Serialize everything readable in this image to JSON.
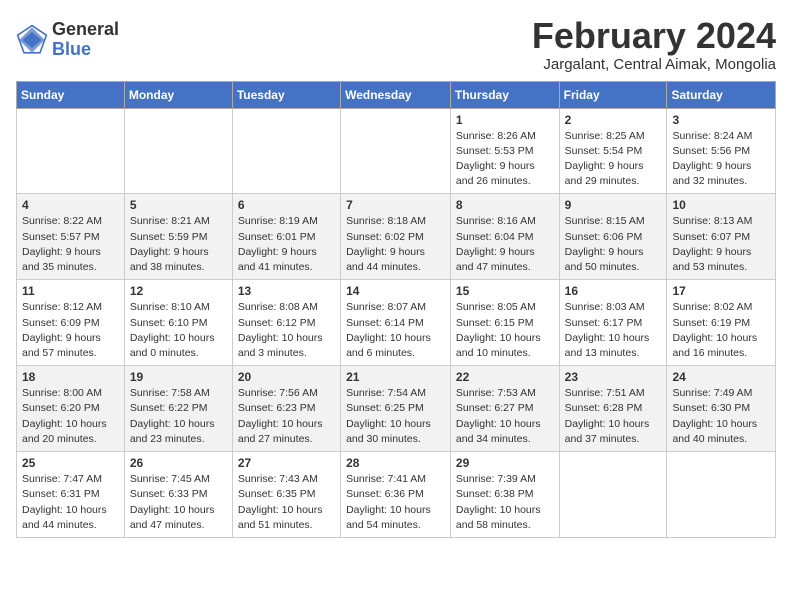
{
  "header": {
    "logo_general": "General",
    "logo_blue": "Blue",
    "month_title": "February 2024",
    "location": "Jargalant, Central Aimak, Mongolia"
  },
  "days_of_week": [
    "Sunday",
    "Monday",
    "Tuesday",
    "Wednesday",
    "Thursday",
    "Friday",
    "Saturday"
  ],
  "weeks": [
    [
      {
        "day": "",
        "info": ""
      },
      {
        "day": "",
        "info": ""
      },
      {
        "day": "",
        "info": ""
      },
      {
        "day": "",
        "info": ""
      },
      {
        "day": "1",
        "info": "Sunrise: 8:26 AM\nSunset: 5:53 PM\nDaylight: 9 hours\nand 26 minutes."
      },
      {
        "day": "2",
        "info": "Sunrise: 8:25 AM\nSunset: 5:54 PM\nDaylight: 9 hours\nand 29 minutes."
      },
      {
        "day": "3",
        "info": "Sunrise: 8:24 AM\nSunset: 5:56 PM\nDaylight: 9 hours\nand 32 minutes."
      }
    ],
    [
      {
        "day": "4",
        "info": "Sunrise: 8:22 AM\nSunset: 5:57 PM\nDaylight: 9 hours\nand 35 minutes."
      },
      {
        "day": "5",
        "info": "Sunrise: 8:21 AM\nSunset: 5:59 PM\nDaylight: 9 hours\nand 38 minutes."
      },
      {
        "day": "6",
        "info": "Sunrise: 8:19 AM\nSunset: 6:01 PM\nDaylight: 9 hours\nand 41 minutes."
      },
      {
        "day": "7",
        "info": "Sunrise: 8:18 AM\nSunset: 6:02 PM\nDaylight: 9 hours\nand 44 minutes."
      },
      {
        "day": "8",
        "info": "Sunrise: 8:16 AM\nSunset: 6:04 PM\nDaylight: 9 hours\nand 47 minutes."
      },
      {
        "day": "9",
        "info": "Sunrise: 8:15 AM\nSunset: 6:06 PM\nDaylight: 9 hours\nand 50 minutes."
      },
      {
        "day": "10",
        "info": "Sunrise: 8:13 AM\nSunset: 6:07 PM\nDaylight: 9 hours\nand 53 minutes."
      }
    ],
    [
      {
        "day": "11",
        "info": "Sunrise: 8:12 AM\nSunset: 6:09 PM\nDaylight: 9 hours\nand 57 minutes."
      },
      {
        "day": "12",
        "info": "Sunrise: 8:10 AM\nSunset: 6:10 PM\nDaylight: 10 hours\nand 0 minutes."
      },
      {
        "day": "13",
        "info": "Sunrise: 8:08 AM\nSunset: 6:12 PM\nDaylight: 10 hours\nand 3 minutes."
      },
      {
        "day": "14",
        "info": "Sunrise: 8:07 AM\nSunset: 6:14 PM\nDaylight: 10 hours\nand 6 minutes."
      },
      {
        "day": "15",
        "info": "Sunrise: 8:05 AM\nSunset: 6:15 PM\nDaylight: 10 hours\nand 10 minutes."
      },
      {
        "day": "16",
        "info": "Sunrise: 8:03 AM\nSunset: 6:17 PM\nDaylight: 10 hours\nand 13 minutes."
      },
      {
        "day": "17",
        "info": "Sunrise: 8:02 AM\nSunset: 6:19 PM\nDaylight: 10 hours\nand 16 minutes."
      }
    ],
    [
      {
        "day": "18",
        "info": "Sunrise: 8:00 AM\nSunset: 6:20 PM\nDaylight: 10 hours\nand 20 minutes."
      },
      {
        "day": "19",
        "info": "Sunrise: 7:58 AM\nSunset: 6:22 PM\nDaylight: 10 hours\nand 23 minutes."
      },
      {
        "day": "20",
        "info": "Sunrise: 7:56 AM\nSunset: 6:23 PM\nDaylight: 10 hours\nand 27 minutes."
      },
      {
        "day": "21",
        "info": "Sunrise: 7:54 AM\nSunset: 6:25 PM\nDaylight: 10 hours\nand 30 minutes."
      },
      {
        "day": "22",
        "info": "Sunrise: 7:53 AM\nSunset: 6:27 PM\nDaylight: 10 hours\nand 34 minutes."
      },
      {
        "day": "23",
        "info": "Sunrise: 7:51 AM\nSunset: 6:28 PM\nDaylight: 10 hours\nand 37 minutes."
      },
      {
        "day": "24",
        "info": "Sunrise: 7:49 AM\nSunset: 6:30 PM\nDaylight: 10 hours\nand 40 minutes."
      }
    ],
    [
      {
        "day": "25",
        "info": "Sunrise: 7:47 AM\nSunset: 6:31 PM\nDaylight: 10 hours\nand 44 minutes."
      },
      {
        "day": "26",
        "info": "Sunrise: 7:45 AM\nSunset: 6:33 PM\nDaylight: 10 hours\nand 47 minutes."
      },
      {
        "day": "27",
        "info": "Sunrise: 7:43 AM\nSunset: 6:35 PM\nDaylight: 10 hours\nand 51 minutes."
      },
      {
        "day": "28",
        "info": "Sunrise: 7:41 AM\nSunset: 6:36 PM\nDaylight: 10 hours\nand 54 minutes."
      },
      {
        "day": "29",
        "info": "Sunrise: 7:39 AM\nSunset: 6:38 PM\nDaylight: 10 hours\nand 58 minutes."
      },
      {
        "day": "",
        "info": ""
      },
      {
        "day": "",
        "info": ""
      }
    ]
  ]
}
